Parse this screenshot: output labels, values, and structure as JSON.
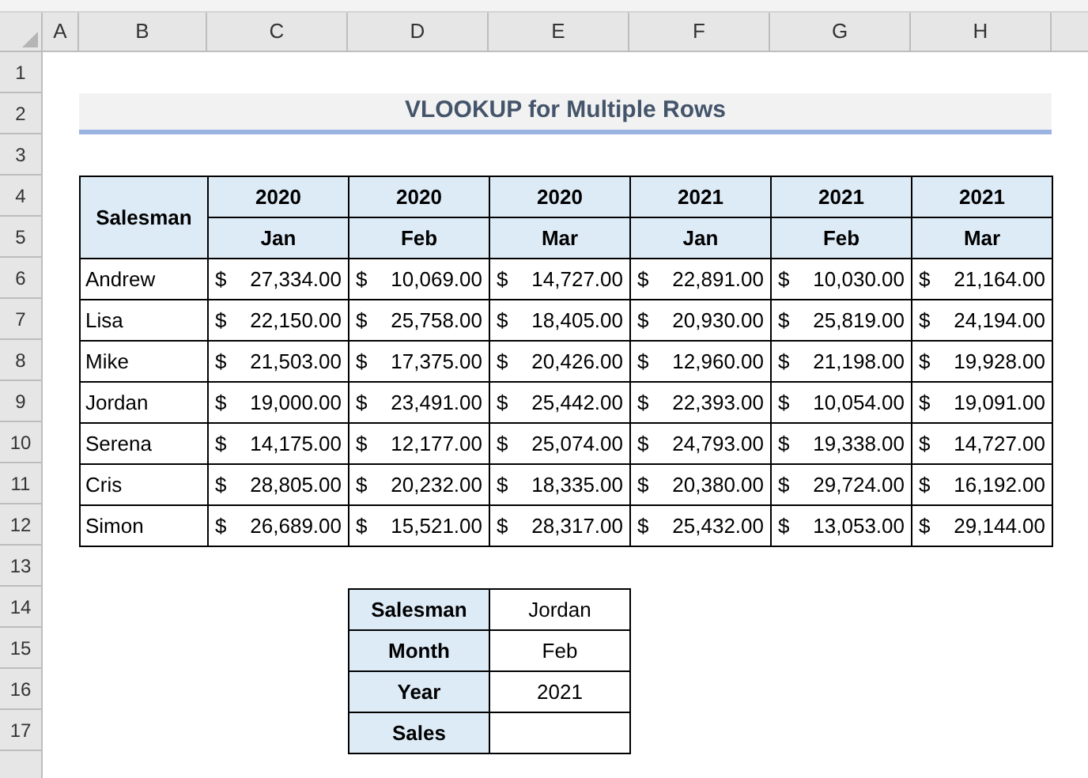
{
  "column_headers": [
    "A",
    "B",
    "C",
    "D",
    "E",
    "F",
    "G",
    "H"
  ],
  "row_headers": [
    "1",
    "2",
    "3",
    "4",
    "5",
    "6",
    "7",
    "8",
    "9",
    "10",
    "11",
    "12",
    "13",
    "14",
    "15",
    "16",
    "17"
  ],
  "title": "VLOOKUP for Multiple Rows",
  "sales_table": {
    "corner": "Salesman",
    "years": [
      "2020",
      "2020",
      "2020",
      "2021",
      "2021",
      "2021"
    ],
    "months": [
      "Jan",
      "Feb",
      "Mar",
      "Jan",
      "Feb",
      "Mar"
    ],
    "rows": [
      {
        "name": "Andrew",
        "values": [
          {
            "currency": "$",
            "amount": "27,334.00"
          },
          {
            "currency": "$",
            "amount": "10,069.00"
          },
          {
            "currency": "$",
            "amount": "14,727.00"
          },
          {
            "currency": "$",
            "amount": "22,891.00"
          },
          {
            "currency": "$",
            "amount": "10,030.00"
          },
          {
            "currency": "$",
            "amount": "21,164.00"
          }
        ]
      },
      {
        "name": "Lisa",
        "values": [
          {
            "currency": "$",
            "amount": "22,150.00"
          },
          {
            "currency": "$",
            "amount": "25,758.00"
          },
          {
            "currency": "$",
            "amount": "18,405.00"
          },
          {
            "currency": "$",
            "amount": "20,930.00"
          },
          {
            "currency": "$",
            "amount": "25,819.00"
          },
          {
            "currency": "$",
            "amount": "24,194.00"
          }
        ]
      },
      {
        "name": "Mike",
        "values": [
          {
            "currency": "$",
            "amount": "21,503.00"
          },
          {
            "currency": "$",
            "amount": "17,375.00"
          },
          {
            "currency": "$",
            "amount": "20,426.00"
          },
          {
            "currency": "$",
            "amount": "12,960.00"
          },
          {
            "currency": "$",
            "amount": "21,198.00"
          },
          {
            "currency": "$",
            "amount": "19,928.00"
          }
        ]
      },
      {
        "name": "Jordan",
        "values": [
          {
            "currency": "$",
            "amount": "19,000.00"
          },
          {
            "currency": "$",
            "amount": "23,491.00"
          },
          {
            "currency": "$",
            "amount": "25,442.00"
          },
          {
            "currency": "$",
            "amount": "22,393.00"
          },
          {
            "currency": "$",
            "amount": "10,054.00"
          },
          {
            "currency": "$",
            "amount": "19,091.00"
          }
        ]
      },
      {
        "name": "Serena",
        "values": [
          {
            "currency": "$",
            "amount": "14,175.00"
          },
          {
            "currency": "$",
            "amount": "12,177.00"
          },
          {
            "currency": "$",
            "amount": "25,074.00"
          },
          {
            "currency": "$",
            "amount": "24,793.00"
          },
          {
            "currency": "$",
            "amount": "19,338.00"
          },
          {
            "currency": "$",
            "amount": "14,727.00"
          }
        ]
      },
      {
        "name": "Cris",
        "values": [
          {
            "currency": "$",
            "amount": "28,805.00"
          },
          {
            "currency": "$",
            "amount": "20,232.00"
          },
          {
            "currency": "$",
            "amount": "18,335.00"
          },
          {
            "currency": "$",
            "amount": "20,380.00"
          },
          {
            "currency": "$",
            "amount": "29,724.00"
          },
          {
            "currency": "$",
            "amount": "16,192.00"
          }
        ]
      },
      {
        "name": "Simon",
        "values": [
          {
            "currency": "$",
            "amount": "26,689.00"
          },
          {
            "currency": "$",
            "amount": "15,521.00"
          },
          {
            "currency": "$",
            "amount": "28,317.00"
          },
          {
            "currency": "$",
            "amount": "25,432.00"
          },
          {
            "currency": "$",
            "amount": "13,053.00"
          },
          {
            "currency": "$",
            "amount": "29,144.00"
          }
        ]
      }
    ]
  },
  "lookup_table": [
    {
      "label": "Salesman",
      "value": "Jordan"
    },
    {
      "label": "Month",
      "value": "Feb"
    },
    {
      "label": "Year",
      "value": "2021"
    },
    {
      "label": "Sales"
    }
  ]
}
